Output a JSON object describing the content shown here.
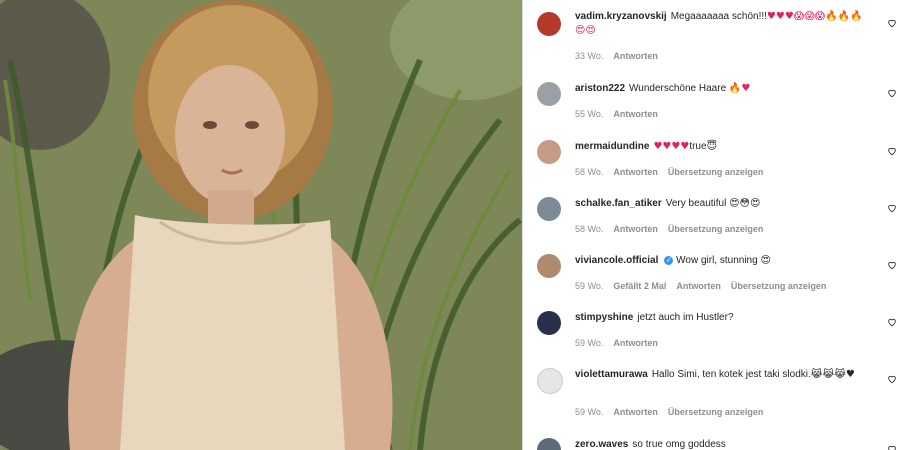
{
  "comments": [
    {
      "user": "vadim.kryzanovskij",
      "text": "Megaaaaaaa schön!!!",
      "emoji": "♥♥♥😱😱😱🔥🔥🔥😍😍",
      "age": "33 Wo.",
      "reply": "Antworten",
      "avatar": "#b33a2b"
    },
    {
      "user": "ariston222",
      "text": "Wunderschöne Haare",
      "emoji": "🔥♥",
      "age": "55 Wo.",
      "reply": "Antworten",
      "avatar": "#9aa0a6"
    },
    {
      "user": "mermaidundine",
      "text": "true",
      "emoji_pre": "♥♥♥♥",
      "emoji": "😇",
      "age": "58 Wo.",
      "reply": "Antworten",
      "translate": "Übersetzung anzeigen",
      "avatar": "#c59a86"
    },
    {
      "user": "schalke.fan_atiker",
      "text": "Very beautiful",
      "emoji": "😍😳😍",
      "age": "58 Wo.",
      "reply": "Antworten",
      "translate": "Übersetzung anzeigen",
      "avatar": "#7c8a96"
    },
    {
      "user": "viviancole.official",
      "verified": true,
      "text": "Wow girl, stunning",
      "emoji": "😍",
      "age": "59 Wo.",
      "likes": "Gefällt 2 Mal",
      "reply": "Antworten",
      "translate": "Übersetzung anzeigen",
      "avatar": "#b08a6e"
    },
    {
      "user": "stimpyshine",
      "text": "jetzt auch im Hustler?",
      "age": "59 Wo.",
      "reply": "Antworten",
      "avatar": "#2a2f4a"
    },
    {
      "user": "violettamurawa",
      "text": "Hallo Simi, ten kotek jest taki slodki.",
      "emoji": "😹😹😹♥",
      "age": "59 Wo.",
      "reply": "Antworten",
      "translate": "Übersetzung anzeigen",
      "avatar": "#e6e6e6"
    },
    {
      "user": "zero.waves",
      "text": "so true omg goddess",
      "avatar": "#5d6b78"
    }
  ],
  "icons": {
    "heart": "heart-outline-icon",
    "verified": "verified-badge-icon"
  }
}
